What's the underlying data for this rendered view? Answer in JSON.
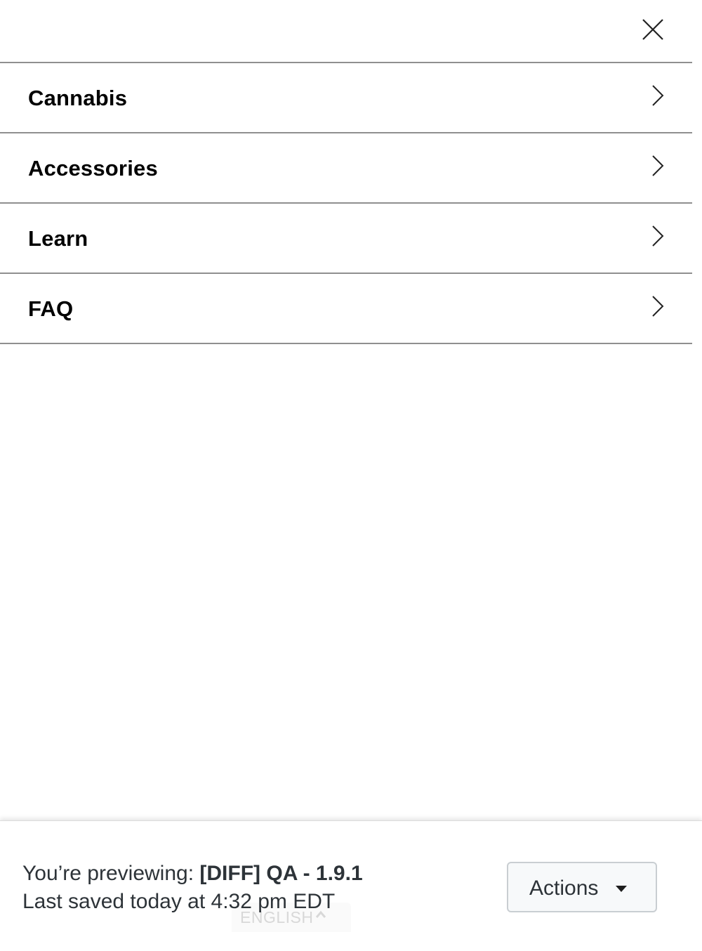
{
  "menu": {
    "close_icon": "close-icon",
    "items": [
      {
        "label": "Cannabis",
        "icon": "chevron-right-icon"
      },
      {
        "label": "Accessories",
        "icon": "chevron-right-icon"
      },
      {
        "label": "Learn",
        "icon": "chevron-right-icon"
      },
      {
        "label": "FAQ",
        "icon": "chevron-right-icon"
      }
    ]
  },
  "preview_bar": {
    "previewing_prefix": "You’re previewing: ",
    "theme_name": "[DIFF] QA - 1.9.1",
    "last_saved": "Last saved today at 4:32 pm EDT",
    "actions_label": "Actions",
    "actions_icon": "caret-down-icon",
    "language_label": "ENGLISH",
    "language_icon": "chevron-up-icon"
  },
  "colors": {
    "divider": "#8f8f8f",
    "text_primary": "#000000",
    "preview_text": "#2d3338",
    "button_border": "#c9ced2",
    "button_bg": "#f7f9fa"
  }
}
